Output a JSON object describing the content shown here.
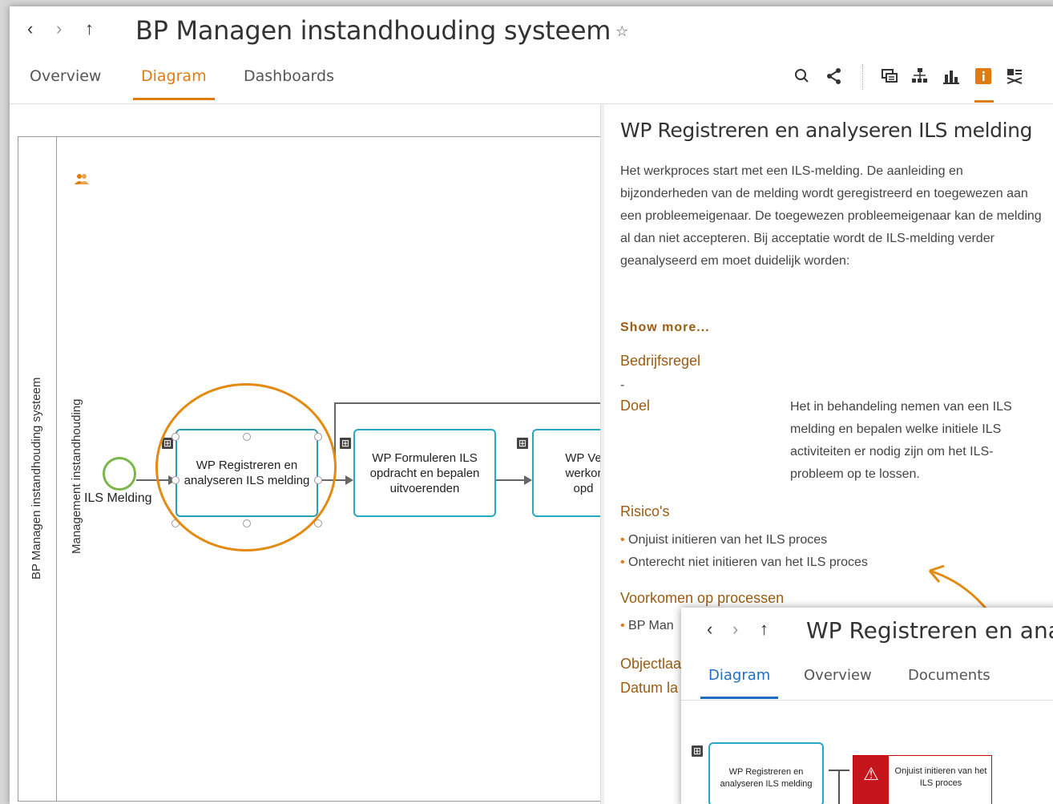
{
  "window": {
    "title": "BP Managen instandhouding systeem",
    "nav": {
      "back": "‹",
      "forward": "›",
      "up": "↑"
    }
  },
  "tabs": {
    "overview": "Overview",
    "diagram": "Diagram",
    "dashboards": "Dashboards"
  },
  "toolbar": [
    "search-icon",
    "share-icon",
    "comments-icon",
    "hierarchy-icon",
    "chart-icon",
    "info-icon",
    "settings-icon"
  ],
  "diagram": {
    "pool_label": "BP Managen instandhouding systeem",
    "lane_label": "Management instandhouding",
    "start_event": "ILS Melding",
    "tasks": [
      "WP Registreren en analyseren ILS melding",
      "WP Formuleren ILS opdracht en bepalen uitvoerenden",
      "WP Ve werkor opd"
    ]
  },
  "panel": {
    "title": "WP Registreren en analyseren ILS melding",
    "description": "Het werkproces start met een ILS-melding. De aanleiding en bijzonderheden van de melding wordt geregistreerd en toegewezen aan een probleemeigenaar. De toegewezen probleemeigenaar kan de melding al dan niet accepteren. Bij acceptatie wordt de ILS-melding verder geanalyseerd em moet duidelijk worden:",
    "show_more": "Show more...",
    "bedrijfsregel_label": "Bedrijfsregel",
    "bedrijfsregel_value": "-",
    "doel_label": "Doel",
    "doel_value": "Het in behandeling nemen van een ILS melding en bepalen welke initiele ILS activiteiten er nodig zijn om het ILS-probleem op te lossen.",
    "risico_label": "Risico's",
    "risicos": [
      "Onjuist initieren van het ILS proces",
      "Onterecht niet initieren van het ILS proces"
    ],
    "voorkomen_label": "Voorkomen op processen",
    "voorkomen_value": "BP Man",
    "objectlaag_label": "Objectlaa",
    "datum_label": "Datum la"
  },
  "popup": {
    "title": "WP Registreren en ana",
    "tabs": {
      "diagram": "Diagram",
      "overview": "Overview",
      "documents": "Documents"
    },
    "task": "WP Registreren en analyseren ILS melding",
    "risk": "Onjuist initieren van het ILS proces"
  }
}
